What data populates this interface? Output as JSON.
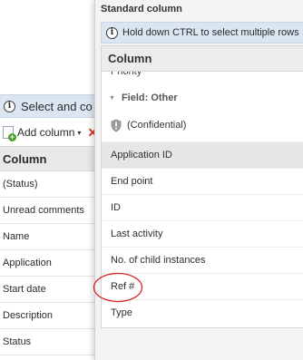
{
  "background_page": {
    "info_bar_text": "Select and co",
    "toolbar": {
      "add_column_label": "Add column",
      "delete_icon": "✕"
    },
    "grid_header": "Column",
    "grid_rows": [
      "(Status)",
      "Unread comments",
      "Name",
      "Application",
      "Start date",
      "Description",
      "Status"
    ]
  },
  "popup": {
    "title": "Standard column",
    "info_text": "Hold down CTRL to select multiple rows",
    "list_header": "Column",
    "clipped_item": "Priority",
    "group_label": "Field: Other",
    "confidential_label": "(Confidential)",
    "items": [
      "Application ID",
      "End point",
      "ID",
      "Last activity",
      "No. of child instances",
      "Ref #",
      "Type"
    ],
    "selected_index": 0,
    "highlighted_item": "Ref #"
  },
  "colors": {
    "info_bar_bg": "#dbe6f2",
    "header_bg": "#ececec",
    "selected_row_bg": "#e6e6e6",
    "highlight_ring": "#d9262a",
    "add_icon_green": "#4a9e2f",
    "delete_icon_red": "#d23b2b"
  },
  "icons": {
    "info": "info-icon",
    "add_column": "add-column-icon",
    "dropdown": "caret-down-icon",
    "delete": "delete-icon",
    "group_toggle": "triangle-down-icon",
    "confidential": "shield-icon"
  }
}
